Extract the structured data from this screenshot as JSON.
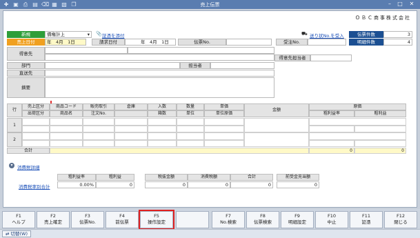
{
  "window": {
    "title": "売上伝票",
    "company": "ＯＢＣ商事株式会社"
  },
  "header": {
    "new_label": "新規",
    "sales_date_label": "売上日付",
    "sales_date_value": "年　4月　1日",
    "billing_date_label": "請求日付",
    "billing_date_value": "年　4月　1日",
    "credit_select": "債権計上",
    "evidence_link": "証憑を添付",
    "slip_no_label": "伝票No.",
    "order_no_label": "受注No.",
    "shipping_link": "送り状No.を受入",
    "slip_count_label": "伝票件数",
    "slip_count_value": "3",
    "detail_count_label": "明細件数",
    "detail_count_value": "4",
    "customer_label": "得意先",
    "customer_rep_label": "得意先担当者",
    "dept_label": "部門",
    "rep_label": "担当者",
    "ship_to_label": "直送先",
    "memo_label": "摘要"
  },
  "grid": {
    "row_header": "行",
    "headers_top": [
      "売上区分",
      "商品コード",
      "販売取引",
      "倉庫",
      "入数",
      "数量",
      "単価",
      "金額",
      "原価"
    ],
    "headers_bottom": [
      "出荷区分",
      "商品名",
      "注文No.",
      "",
      "箱数",
      "単位",
      "単位原価",
      "粗利益率",
      "粗利益"
    ],
    "rows": [
      "1",
      "2"
    ],
    "total_label": "合計",
    "total_amount": "0",
    "total_cost": "0"
  },
  "tax": {
    "detail_toggle": "消費税詳細",
    "by_rate_label": "消費税率別合計",
    "headers": [
      "粗利益率",
      "粗利益",
      "税抜金額",
      "消費税額",
      "合計",
      "前受金充当額"
    ],
    "values": [
      "0.00%",
      "0",
      "0",
      "0",
      "0",
      "0"
    ]
  },
  "fkeys": [
    {
      "key": "F1",
      "label": "ヘルプ"
    },
    {
      "key": "F2",
      "label": "売上確定"
    },
    {
      "key": "F3",
      "label": "伝票No."
    },
    {
      "key": "F4",
      "label": "前伝票"
    },
    {
      "key": "F5",
      "label": "操作設定"
    },
    {
      "key": "",
      "label": ""
    },
    {
      "key": "F7",
      "label": "No.検索"
    },
    {
      "key": "F8",
      "label": "伝票検索"
    },
    {
      "key": "F9",
      "label": "明細設定"
    },
    {
      "key": "F10",
      "label": "中止"
    },
    {
      "key": "F11",
      "label": "証憑"
    },
    {
      "key": "F12",
      "label": "閉じる"
    }
  ],
  "statusbar": {
    "switch_label": "切替(W)"
  }
}
